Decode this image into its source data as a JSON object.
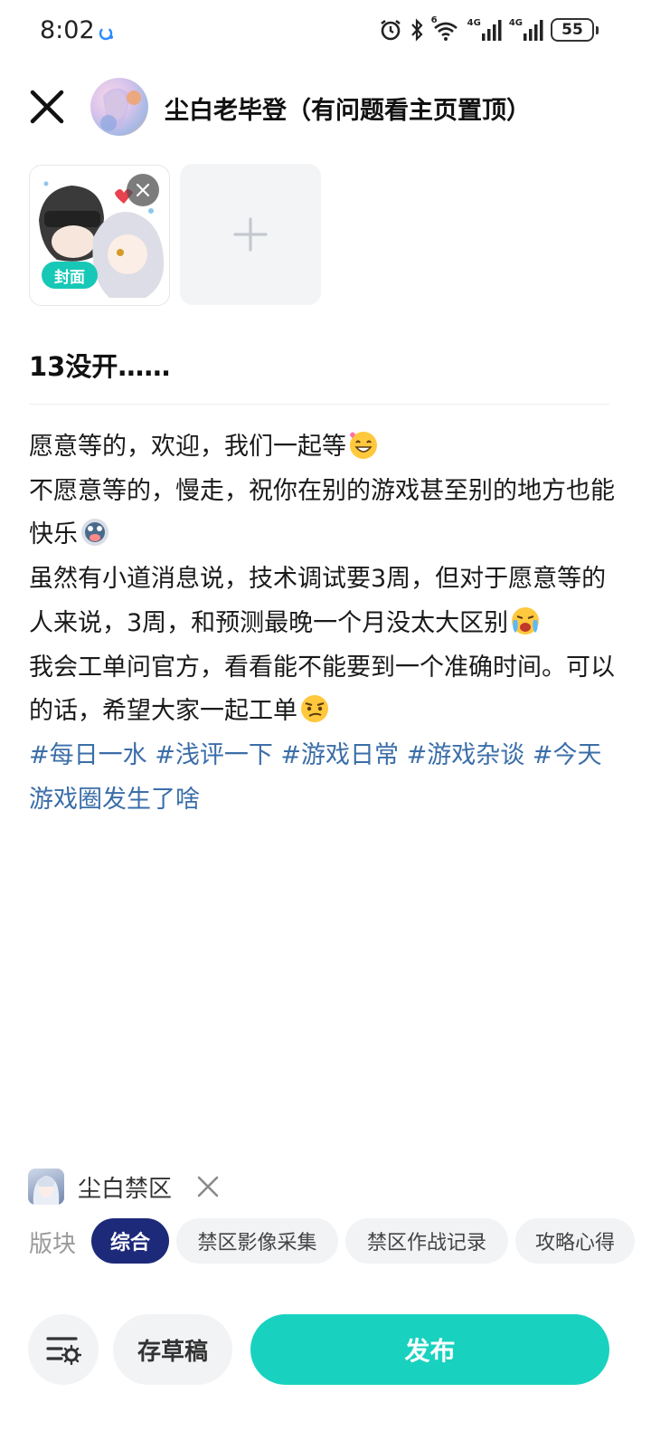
{
  "status_bar": {
    "time": "8:02",
    "battery": "55",
    "net1": "4G",
    "net2": "4G",
    "wifi_label": "6"
  },
  "header": {
    "title": "尘白老毕登（有问题看主页置顶）"
  },
  "images": {
    "cover_label": "封面"
  },
  "post": {
    "title": "13没开……",
    "paragraphs": {
      "p1": "愿意等的，欢迎，我们一起等",
      "p2": "不愿意等的，慢走，祝你在别的游戏甚至别的地方也能快乐",
      "p3": "虽然有小道消息说，技术调试要3周，但对于愿意等的人来说，3周，和预测最晚一个月没太大区别",
      "p4": "我会工单问官方，看看能不能要到一个准确时间。可以的话，希望大家一起工单",
      "tags": "#每日一水 #浅评一下 #游戏日常 #游戏杂谈 #今天游戏圈发生了啥"
    }
  },
  "section": {
    "name": "尘白禁区",
    "board_label": "版块",
    "boards": [
      "综合",
      "禁区影像采集",
      "禁区作战记录",
      "攻略心得"
    ]
  },
  "actions": {
    "draft": "存草稿",
    "publish": "发布"
  },
  "colors": {
    "accent": "#18d2bf",
    "active_chip": "#1d2a7a",
    "tag": "#3b6ea8",
    "cover_badge": "#18c8b7"
  }
}
